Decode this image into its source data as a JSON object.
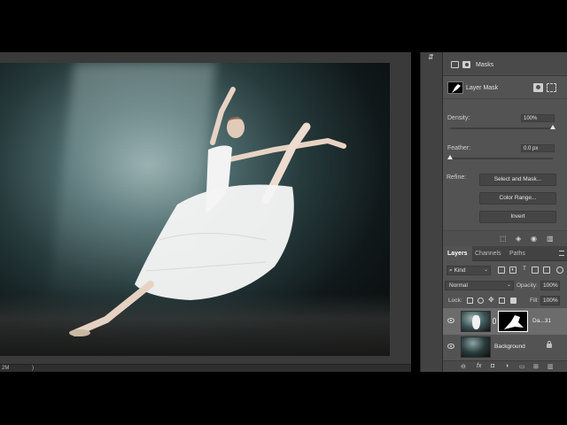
{
  "status": {
    "doc_size": "2M",
    "arrow": ")"
  },
  "properties": {
    "title": "Masks",
    "mask_label": "Layer Mask",
    "density_label": "Density:",
    "density_value": "100%",
    "density": 1.0,
    "feather_label": "Feather:",
    "feather_value": "0.0 px",
    "feather": 0.0,
    "refine_label": "Refine:",
    "buttons": {
      "select_and_mask": "Select and Mask...",
      "color_range": "Color Range...",
      "invert": "Invert"
    }
  },
  "layers_panel": {
    "tabs": [
      "Layers",
      "Channels",
      "Paths"
    ],
    "active_tab": "Layers",
    "filter_kind": "Kind",
    "blend_mode": "Normal",
    "opacity_label": "Opacity:",
    "opacity_value": "100%",
    "lock_label": "Lock:",
    "fill_label": "Fill:",
    "fill_value": "100%",
    "layers": [
      {
        "name": "Da...31",
        "selected": true
      },
      {
        "name": "Background",
        "selected": false
      }
    ],
    "footer_fx": "fx"
  },
  "colors": {
    "panel_bg": "#535353",
    "selected_layer": "#6c6c6c",
    "button_bg": "#454545"
  }
}
